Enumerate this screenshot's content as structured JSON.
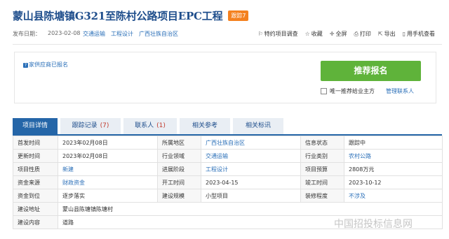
{
  "header": {
    "title": "蒙山县陈塘镇G321至陈村公路项目EPC工程",
    "badge": "跟踪7"
  },
  "meta": {
    "publish_label": "发布日期：",
    "publish_date": "2023-02-08",
    "tags": [
      "交通运输",
      "工程设计",
      "广西壮族自治区"
    ]
  },
  "tools": [
    {
      "icon": "star-icon",
      "glyph": "⚐",
      "label": "特约项目调查"
    },
    {
      "icon": "favorite-icon",
      "glyph": "☆",
      "label": "收藏"
    },
    {
      "icon": "fullscreen-icon",
      "glyph": "✛",
      "label": "全屏"
    },
    {
      "icon": "print-icon",
      "glyph": "⎙",
      "label": "打印"
    },
    {
      "icon": "export-icon",
      "glyph": "⇱",
      "label": "导出"
    },
    {
      "icon": "mobile-icon",
      "glyph": "▯",
      "label": "用手机查看"
    }
  ],
  "apply": {
    "knowledge": "家供应商已报名",
    "knowledge_icon": "?",
    "button": "推荐报名",
    "checkbox_label": "唯一推荐给业主方",
    "manage_link": "管理联系人"
  },
  "tabs": [
    {
      "label": "项目详情",
      "count": ""
    },
    {
      "label": "跟踪记录",
      "count": "(7)"
    },
    {
      "label": "联系人",
      "count": "(1)"
    },
    {
      "label": "相关参考",
      "count": ""
    },
    {
      "label": "相关标讯",
      "count": ""
    }
  ],
  "details": {
    "r1": {
      "l1": "首发时间",
      "v1": "2023年02月08日",
      "l2": "所属地区",
      "v2": "广西壮族自治区",
      "l3": "信息状态",
      "v3": "跟踪中"
    },
    "r2": {
      "l1": "更新时间",
      "v1": "2023年02月08日",
      "l2": "行业领域",
      "v2": "交通运输",
      "l3": "行业类别",
      "v3": "农村公路"
    },
    "r3": {
      "l1": "项目性质",
      "v1": "新建",
      "l2": "进展阶段",
      "v2": "工程设计",
      "l3": "项目预算",
      "v3": "2808万元"
    },
    "r4": {
      "l1": "资金来源",
      "v1": "财政资金",
      "l2": "开工时间",
      "v2": "2023-04-15",
      "l3": "竣工时间",
      "v3": "2023-10-12"
    },
    "r5": {
      "l1": "资金到位",
      "v1": "逐步落实",
      "l2": "建设规模",
      "v2": "小型项目",
      "l3": "装修程度",
      "v3": "不涉及"
    },
    "r6": {
      "l1": "建设地址",
      "v1": "蒙山县陈塘镇陈塘村"
    },
    "r7": {
      "l1": "建设内容",
      "v1": "道路"
    }
  },
  "watermark": "中国招投标信息网"
}
